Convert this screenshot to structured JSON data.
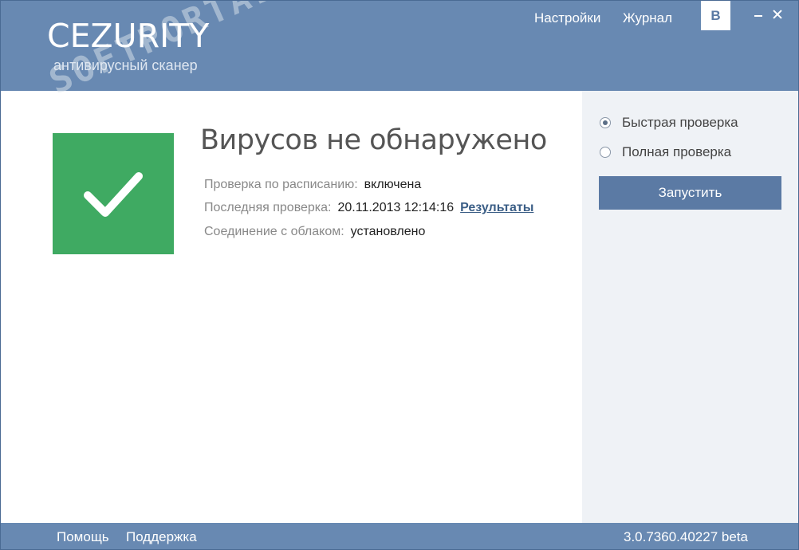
{
  "header": {
    "brand": "CEZURITY",
    "brand_subtitle": "антивирусный сканер",
    "watermark": "SOFTPORTAL",
    "nav": {
      "settings": "Настройки",
      "journal": "Журнал"
    },
    "vk_label": "В"
  },
  "status": {
    "title": "Вирусов не обнаружено",
    "color": "#3faa62",
    "icon": "checkmark-icon",
    "rows": {
      "schedule": {
        "label": "Проверка по расписанию:",
        "value": "включена"
      },
      "last_scan": {
        "label": "Последняя проверка:",
        "value": "20.11.2013 12:14:16",
        "link": "Результаты"
      },
      "cloud": {
        "label": "Соединение с облаком:",
        "value": "установлено"
      }
    }
  },
  "side": {
    "quick_scan": "Быстрая проверка",
    "full_scan": "Полная проверка",
    "selected": "quick_scan",
    "start_button": "Запустить"
  },
  "footer": {
    "help": "Помощь",
    "support": "Поддержка",
    "version": "3.0.7360.40227 beta"
  },
  "colors": {
    "header_bg": "#6889b2",
    "button_bg": "#5b7aa4",
    "side_bg": "#eff2f6"
  }
}
